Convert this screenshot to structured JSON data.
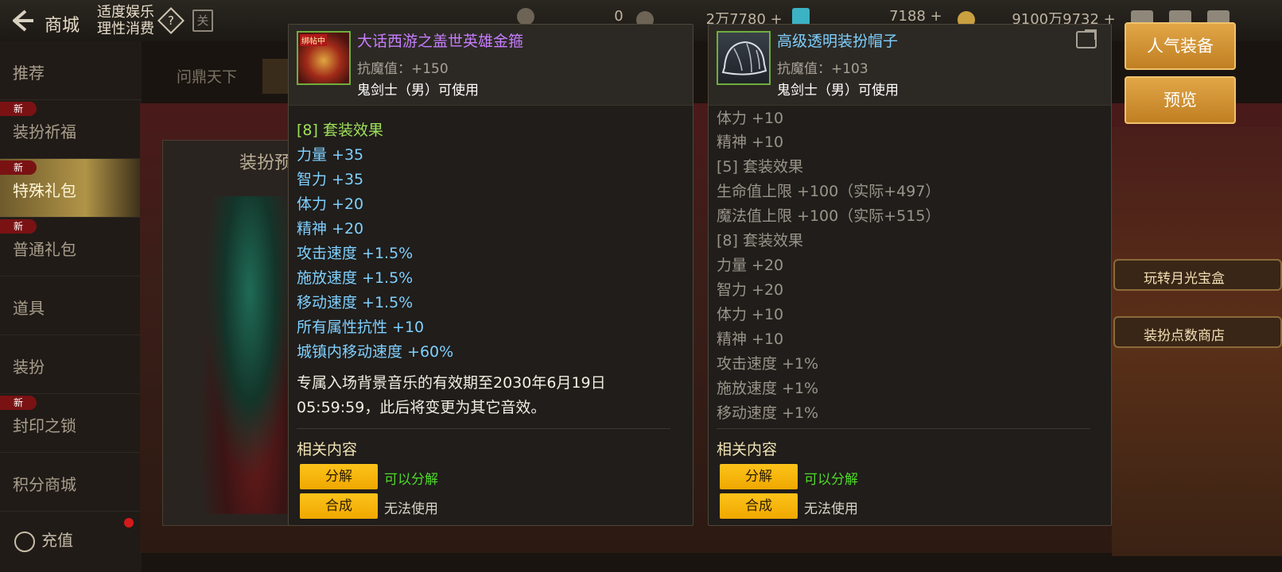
{
  "topbar": {
    "shop_title": "商城",
    "notice_line1": "适度娱乐",
    "notice_line2": "理性消费",
    "help_glyph": "?",
    "calendar_glyph": "关",
    "currency": [
      {
        "value": "0",
        "color": "#6d6456"
      },
      {
        "value": "2万7780 +",
        "color": "#6d6456"
      },
      {
        "value": "7188 +",
        "color": "#3bb3c4"
      },
      {
        "value": "9100万9732 +",
        "color": "#c9a040"
      }
    ]
  },
  "sidebar": {
    "items": [
      {
        "label": "推荐",
        "new": false,
        "active": false
      },
      {
        "label": "装扮祈福",
        "new": true,
        "active": false
      },
      {
        "label": "特殊礼包",
        "new": true,
        "active": true
      },
      {
        "label": "普通礼包",
        "new": true,
        "active": false
      },
      {
        "label": "道具",
        "new": false,
        "active": false
      },
      {
        "label": "装扮",
        "new": false,
        "active": false
      },
      {
        "label": "封印之锁",
        "new": true,
        "active": false
      },
      {
        "label": "积分商城",
        "new": false,
        "active": false
      }
    ],
    "new_badge": "新",
    "recharge_label": "充值"
  },
  "background": {
    "tab_label": "问鼎天下",
    "preview_title": "装扮预",
    "promo1": "玩转月光宝盒",
    "promo2": "装扮点数商店"
  },
  "right_buttons": {
    "popular": "人气装备",
    "preview": "预览"
  },
  "left_panel": {
    "icon_badge": "绑帖中",
    "name": "大话西游之盖世英雄金箍",
    "name_color": "#c77dff",
    "stat": "抗魔值：+150",
    "usable": "鬼剑士（男）可使用",
    "lines": [
      {
        "text": "[8] 套装效果",
        "cls": "c-green"
      },
      {
        "text": "力量 +35",
        "cls": "c-cyan"
      },
      {
        "text": "智力 +35",
        "cls": "c-cyan"
      },
      {
        "text": "体力 +20",
        "cls": "c-cyan"
      },
      {
        "text": "精神 +20",
        "cls": "c-cyan"
      },
      {
        "text": "攻击速度 +1.5%",
        "cls": "c-cyan"
      },
      {
        "text": "施放速度 +1.5%",
        "cls": "c-cyan"
      },
      {
        "text": "移动速度 +1.5%",
        "cls": "c-cyan"
      },
      {
        "text": "所有属性抗性 +10",
        "cls": "c-cyan"
      },
      {
        "text": "城镇内移动速度 +60%",
        "cls": "c-cyan"
      }
    ],
    "description": "专属入场背景音乐的有效期至2030年6月19日05:59:59，此后将变更为其它音效。",
    "related_title": "相关内容",
    "actions": [
      {
        "button": "分解",
        "status": "可以分解",
        "status_color": "#4fd82a"
      },
      {
        "button": "合成",
        "status": "无法使用",
        "status_color": "#d8d2c6"
      }
    ]
  },
  "right_panel": {
    "name": "高级透明装扮帽子",
    "name_color": "#7fd0ff",
    "stat": "抗魔值：+103",
    "usable": "鬼剑士（男）可使用",
    "lines": [
      {
        "text": "体力 +10",
        "cls": "c-gray"
      },
      {
        "text": "精神 +10",
        "cls": "c-gray"
      },
      {
        "text": "[5] 套装效果",
        "cls": "c-gray"
      },
      {
        "text": "生命值上限 +100（实际+497）",
        "cls": "c-gray"
      },
      {
        "text": "魔法值上限 +100（实际+515）",
        "cls": "c-gray"
      },
      {
        "text": "[8] 套装效果",
        "cls": "c-gray"
      },
      {
        "text": "力量 +20",
        "cls": "c-gray"
      },
      {
        "text": "智力 +20",
        "cls": "c-gray"
      },
      {
        "text": "体力 +10",
        "cls": "c-gray"
      },
      {
        "text": "精神 +10",
        "cls": "c-gray"
      },
      {
        "text": "攻击速度 +1%",
        "cls": "c-gray"
      },
      {
        "text": "施放速度 +1%",
        "cls": "c-gray"
      },
      {
        "text": "移动速度 +1%",
        "cls": "c-gray"
      }
    ],
    "related_title": "相关内容",
    "actions": [
      {
        "button": "分解",
        "status": "可以分解",
        "status_color": "#4fd82a"
      },
      {
        "button": "合成",
        "status": "无法使用",
        "status_color": "#d8d2c6"
      }
    ]
  }
}
